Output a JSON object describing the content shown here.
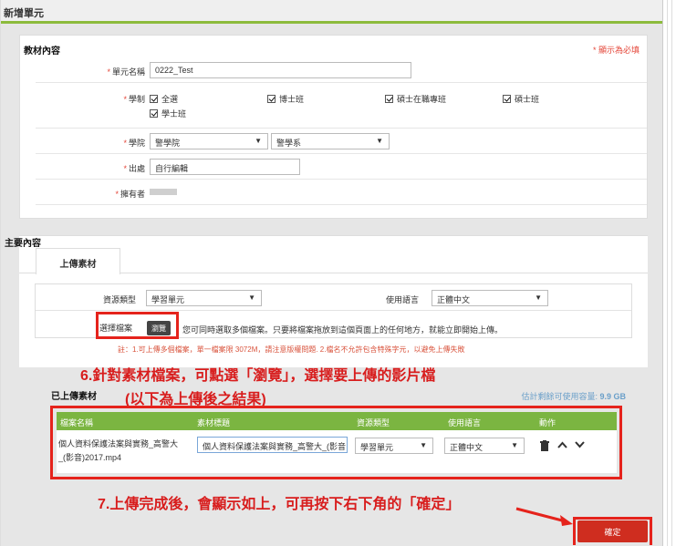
{
  "page": {
    "title": "新增單元"
  },
  "section_content": {
    "title": "教材內容",
    "required_note": "* 顯示為必填",
    "unit_name": {
      "label": "單元名稱",
      "value": "0222_Test"
    },
    "system": {
      "label": "學制",
      "options": [
        "全選",
        "博士班",
        "碩士在職專班",
        "碩士班",
        "學士班"
      ]
    },
    "college": {
      "label": "學院",
      "college_value": "警學院",
      "dept_value": "警學系"
    },
    "source": {
      "label": "出處",
      "value": "自行編輯"
    },
    "owner": {
      "label": "擁有者"
    }
  },
  "section_main": {
    "title": "主要內容",
    "tab_label": "上傳素材",
    "resource_type": {
      "label": "資源類型",
      "value": "學習單元"
    },
    "language": {
      "label": "使用語言",
      "value": "正體中文"
    },
    "select_file": {
      "label": "選擇檔案",
      "browse_label": "瀏覽",
      "hint": "您可同時選取多個檔案。只要將檔案拖放到這個頁面上的任何地方，就能立即開始上傳。"
    },
    "note": "註：1.可上傳多個檔案，單一檔案限 3072M，請注意版權問題. 2.檔名不允許包含特殊字元，以避免上傳失敗",
    "uploaded_title": "已上傳素材",
    "quota_label": "估計剩餘可使用容量:",
    "quota_value": "9.9 GB",
    "table": {
      "headers": [
        "檔案名稱",
        "素材標題",
        "資源類型",
        "使用語言",
        "動作"
      ],
      "rows": [
        {
          "filename": "個人資料保護法案與實務_高警大_(影音)2017.mp4",
          "title": "個人資料保護法案與實務_高警大_(影音",
          "type": "學習單元",
          "language": "正體中文"
        }
      ]
    },
    "confirm_label": "確定"
  },
  "annotations": {
    "step6_line1": "6.針對素材檔案，可點選「瀏覽」，選擇要上傳的影片檔",
    "step6_line2": "(以下為上傳後之結果)",
    "step7": "7.上傳完成後，會顯示如上，可再按下右下角的「確定」"
  },
  "colors": {
    "accent_green": "#7bb541",
    "annotation_red": "#e5231c",
    "confirm_red": "#cf2d1f"
  }
}
